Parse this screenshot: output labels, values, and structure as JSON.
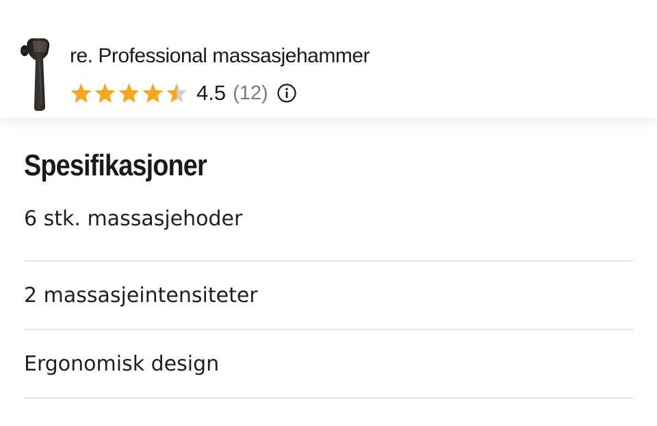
{
  "product": {
    "title": "re. Professional massasjehammer",
    "rating": 4.5,
    "rating_max": 5,
    "rating_value_label": "4.5",
    "review_count_label": "(12)",
    "star_color": "#f5a623",
    "star_empty_color": "#cfcfcf",
    "info_icon": "info-circle-icon"
  },
  "specs": {
    "title": "Spesifikasjoner",
    "items": [
      {
        "label": "6 stk. massasjehoder"
      },
      {
        "label": "2 massasjeintensiteter"
      },
      {
        "label": "Ergonomisk design"
      }
    ]
  }
}
